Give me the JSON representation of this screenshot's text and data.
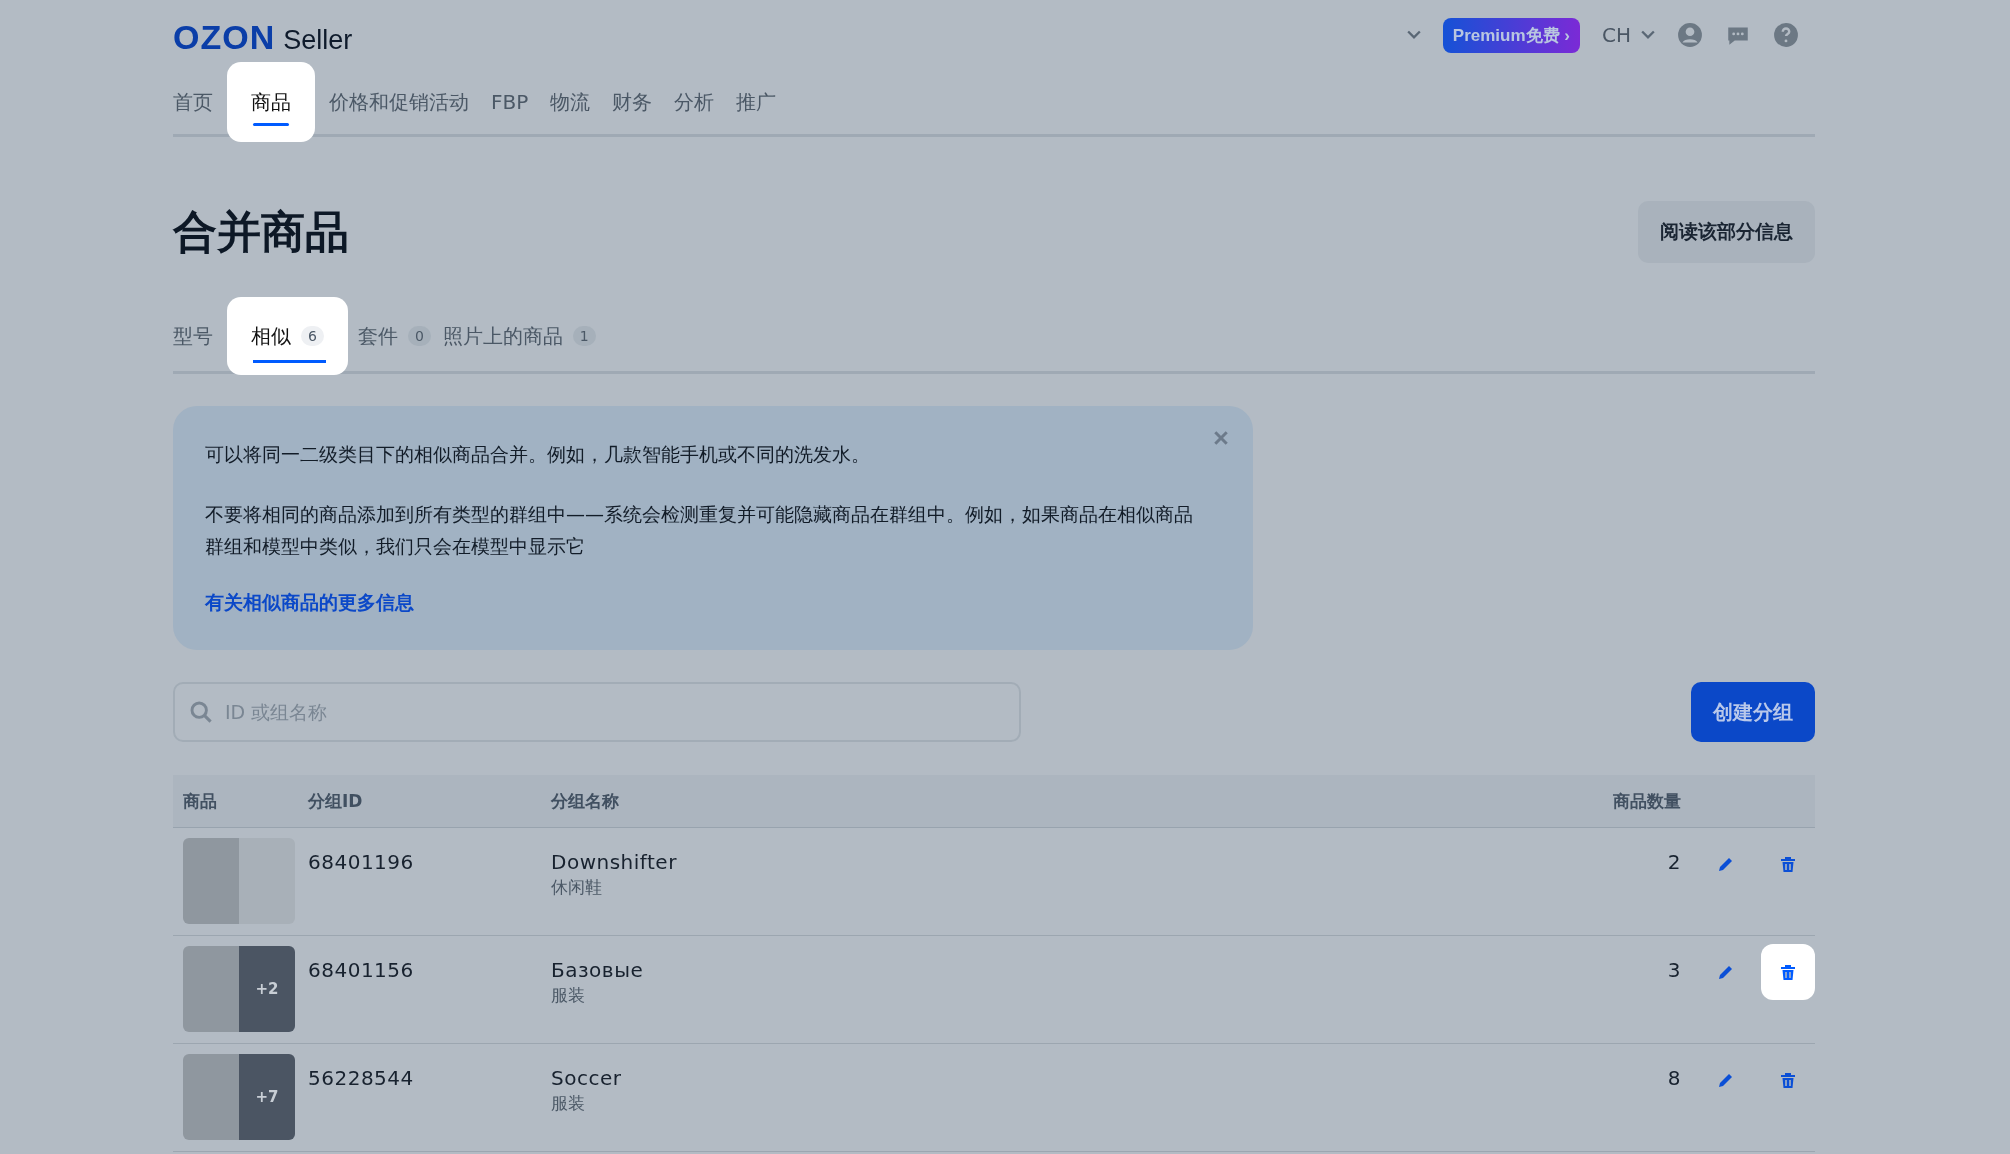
{
  "header": {
    "logo": "OZON",
    "logo_suffix": "Seller",
    "premium": "Premium免费",
    "premium_arrow": "›",
    "language": "CH"
  },
  "nav": [
    {
      "label": "首页",
      "selected": false
    },
    {
      "label": "商品",
      "selected": true
    },
    {
      "label": "价格和促销活动",
      "selected": false
    },
    {
      "label": "FBP",
      "selected": false
    },
    {
      "label": "物流",
      "selected": false
    },
    {
      "label": "财务",
      "selected": false
    },
    {
      "label": "分析",
      "selected": false
    },
    {
      "label": "推广",
      "selected": false
    }
  ],
  "page_title": "合并商品",
  "read_more_button": "阅读该部分信息",
  "tabs": [
    {
      "label": "型号",
      "selected": false
    },
    {
      "label": "相似",
      "count": "6",
      "selected": true
    },
    {
      "label": "套件",
      "count": "0",
      "selected": false
    },
    {
      "label": "照片上的商品",
      "count": "1",
      "selected": false
    }
  ],
  "notice": {
    "paragraphs": [
      "可以将同一二级类目下的相似商品合并。例如，几款智能手机或不同的洗发水。",
      "不要将相同的商品添加到所有类型的群组中——系统会检测重复并可能隐藏商品在群组中。例如，如果商品在相似商品群组和模型中类似，我们只会在模型中显示它"
    ],
    "link": "有关相似商品的更多信息"
  },
  "search": {
    "placeholder": "ID 或组名称"
  },
  "create_button": "创建分组",
  "table": {
    "columns": [
      "商品",
      "分组ID",
      "分组名称",
      "商品数量"
    ],
    "rows": [
      {
        "id": "68401196",
        "name": "Downshifter",
        "category": "休闲鞋",
        "count": "2",
        "delete_highlighted": false
      },
      {
        "id": "68401156",
        "name": "Базовые",
        "category": "服装",
        "count": "3",
        "extra": "+2",
        "delete_highlighted": true
      },
      {
        "id": "56228544",
        "name": "Soccer",
        "category": "服装",
        "count": "8",
        "extra": "+7",
        "delete_highlighted": false
      }
    ]
  }
}
